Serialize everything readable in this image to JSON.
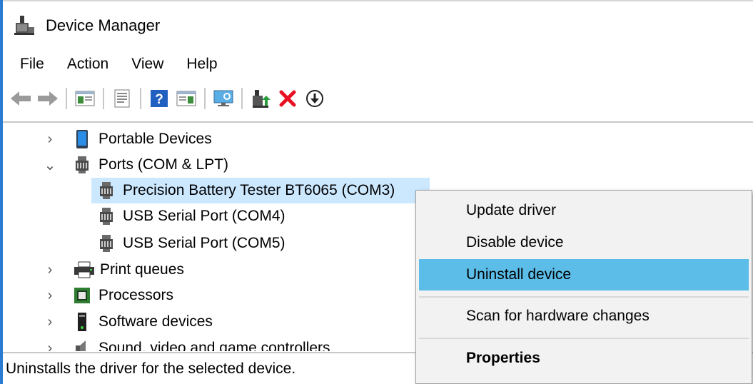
{
  "window": {
    "title": "Device Manager",
    "icon": "device-manager-icon"
  },
  "menu": [
    "File",
    "Action",
    "View",
    "Help"
  ],
  "toolbar": {
    "buttons": [
      "back-arrow-icon",
      "forward-arrow-icon",
      "show-hide-console-tree-icon",
      "properties-sheet-icon",
      "help-icon",
      "action-pane-icon",
      "monitor-icon",
      "update-driver-icon",
      "uninstall-icon",
      "download-circle-icon"
    ],
    "colors": {
      "update_green": "#2a9d3b",
      "uninstall_red": "#e81123",
      "help_blue": "#2060c0"
    }
  },
  "tree": {
    "nodes": [
      {
        "label": "Portable Devices",
        "icon": "portable-device-icon",
        "expanded": false
      },
      {
        "label": "Ports (COM & LPT)",
        "icon": "port-icon",
        "expanded": true,
        "children": [
          {
            "label": "Precision Battery Tester BT6065 (COM3)",
            "icon": "port-icon",
            "selected": true
          },
          {
            "label": "USB Serial Port (COM4)",
            "icon": "port-icon"
          },
          {
            "label": "USB Serial Port (COM5)",
            "icon": "port-icon"
          }
        ]
      },
      {
        "label": "Print queues",
        "icon": "printer-icon",
        "expanded": false
      },
      {
        "label": "Processors",
        "icon": "processor-icon",
        "expanded": false
      },
      {
        "label": "Software devices",
        "icon": "software-device-icon",
        "expanded": false
      },
      {
        "label": "Sound, video and game controllers",
        "icon": "sound-icon",
        "expanded": false
      }
    ]
  },
  "context_menu": {
    "items": [
      {
        "label": "Update driver"
      },
      {
        "label": "Disable device"
      },
      {
        "label": "Uninstall device",
        "highlighted": true
      },
      {
        "label": "Scan for hardware changes"
      },
      {
        "label": "Properties",
        "bold": true
      }
    ]
  },
  "status": {
    "text": "Uninstalls the driver for the selected device."
  },
  "colors": {
    "selection": "#cce8ff",
    "menu_highlight": "#5bbde8",
    "frame": "#2b7bd3"
  }
}
